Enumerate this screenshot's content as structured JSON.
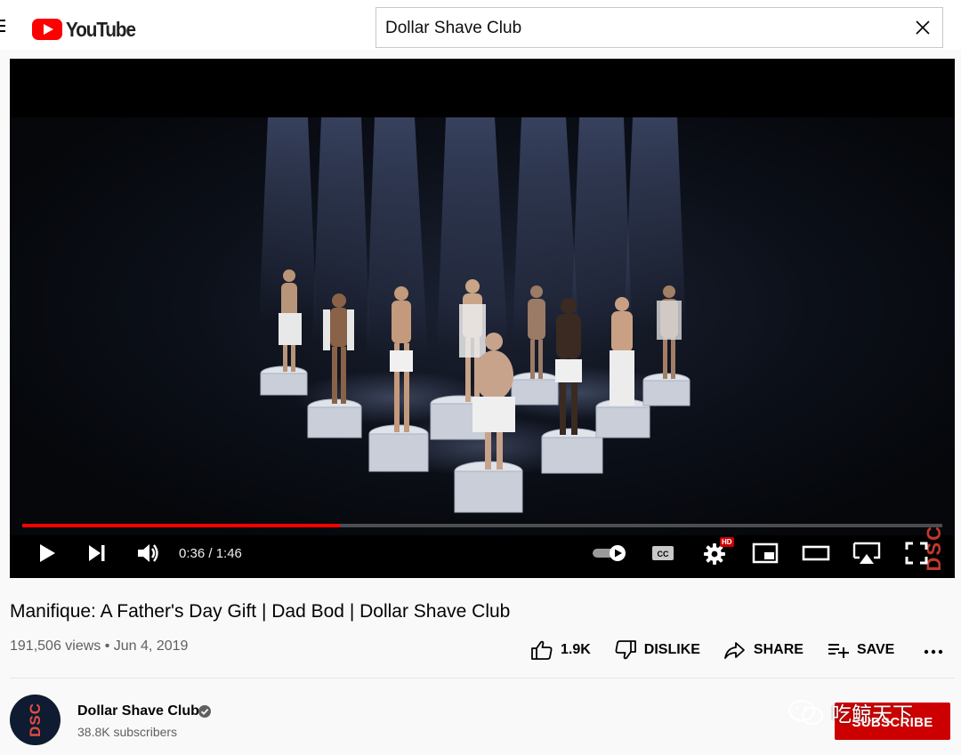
{
  "masthead": {
    "logo_text": "YouTube",
    "search": {
      "value": "Dollar Shave Club"
    }
  },
  "player": {
    "watermark": "DSC",
    "current_time": "0:36",
    "duration": "1:46",
    "time_text": "0:36 / 1:46",
    "progress_fraction": 0.345,
    "buffered_fraction": 1.0,
    "hd_badge": "HD",
    "icons": [
      "play-icon",
      "next-icon",
      "volume-icon",
      "autoplay-toggle-icon",
      "captions-icon",
      "settings-icon",
      "miniplayer-icon",
      "theater-icon",
      "airplay-icon",
      "fullscreen-icon"
    ],
    "accent_color": "#ff0000"
  },
  "video": {
    "title": "Manifique: A Father's Day Gift | Dad Bod | Dollar Shave Club",
    "meta": "191,506 views • Jun 4, 2019",
    "actions": {
      "like_label": "1.9K",
      "dislike_label": "DISLIKE",
      "share_label": "SHARE",
      "save_label": "SAVE"
    }
  },
  "channel": {
    "avatar_text": "DSC",
    "name": "Dollar Shave Club",
    "subscribers": "38.8K subscribers",
    "subscribe_label": "SUBSCRIBE",
    "subscribe_color": "#cc0000"
  },
  "overlay_watermark": {
    "text": "吃鲸天下"
  }
}
